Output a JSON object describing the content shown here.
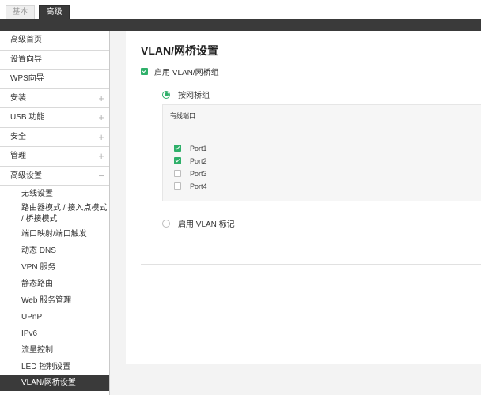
{
  "tabs": [
    {
      "label": "基本",
      "active": false
    },
    {
      "label": "高级",
      "active": true
    }
  ],
  "sidebar": {
    "items": [
      {
        "label": "高级首页",
        "expandable": false,
        "expand_symbol": ""
      },
      {
        "label": "设置向导",
        "expandable": false,
        "expand_symbol": ""
      },
      {
        "label": "WPS向导",
        "expandable": false,
        "expand_symbol": ""
      },
      {
        "label": "安装",
        "expandable": true,
        "expand_symbol": "+"
      },
      {
        "label": "USB 功能",
        "expandable": true,
        "expand_symbol": "+"
      },
      {
        "label": "安全",
        "expandable": true,
        "expand_symbol": "+"
      },
      {
        "label": "管理",
        "expandable": true,
        "expand_symbol": "+"
      },
      {
        "label": "高级设置",
        "expandable": true,
        "expand_symbol": "−"
      }
    ],
    "sub_items": [
      {
        "label": "无线设置",
        "active": false
      },
      {
        "label": "路由器模式 / 接入点模式 / 桥接模式",
        "active": false
      },
      {
        "label": "端口映射/端口触发",
        "active": false
      },
      {
        "label": "动态 DNS",
        "active": false
      },
      {
        "label": "VPN 服务",
        "active": false
      },
      {
        "label": "静态路由",
        "active": false
      },
      {
        "label": "Web 服务管理",
        "active": false
      },
      {
        "label": "UPnP",
        "active": false
      },
      {
        "label": "IPv6",
        "active": false
      },
      {
        "label": "流量控制",
        "active": false
      },
      {
        "label": "LED 控制设置",
        "active": false
      },
      {
        "label": "VLAN/网桥设置",
        "active": true
      }
    ]
  },
  "main": {
    "title": "VLAN/网桥设置",
    "enable_group": {
      "label": "启用 VLAN/网桥组",
      "checked": true
    },
    "bridge_option": {
      "label": "按网桥组",
      "selected": true
    },
    "wired_ports": {
      "header": "有线端口",
      "ports": [
        {
          "label": "Port1",
          "checked": true
        },
        {
          "label": "Port2",
          "checked": true
        },
        {
          "label": "Port3",
          "checked": false
        },
        {
          "label": "Port4",
          "checked": false
        }
      ]
    },
    "vlan_option": {
      "label": "启用 VLAN 标记",
      "selected": false
    }
  },
  "colors": {
    "accent": "#2fb06a",
    "dark": "#3a3a3a"
  }
}
